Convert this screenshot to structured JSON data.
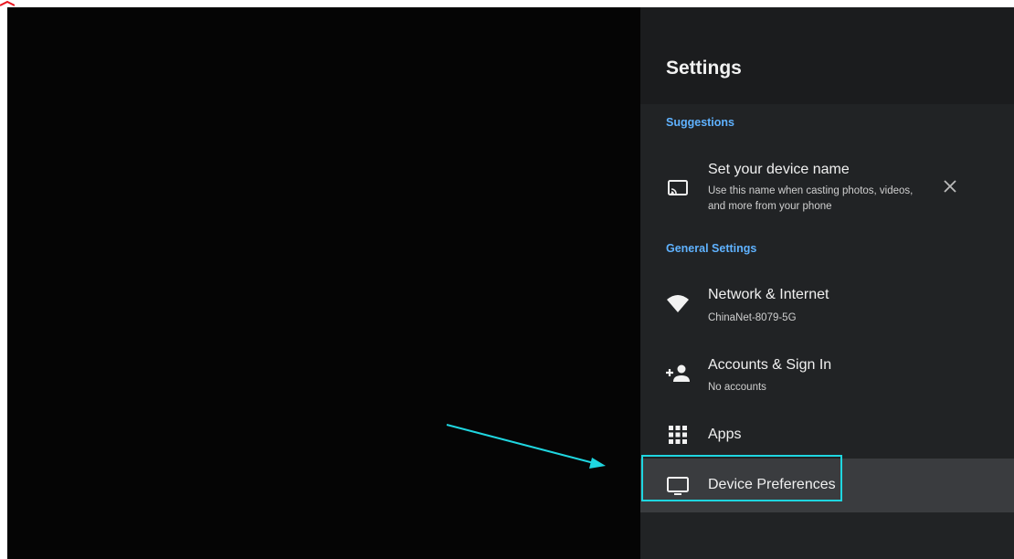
{
  "settings": {
    "title": "Settings",
    "suggestions_label": "Suggestions",
    "general_label": "General Settings",
    "suggestion": {
      "title": "Set your device name",
      "subtitle_line1": "Use this name when casting photos, videos,",
      "subtitle_line2": "and more from your phone",
      "icon": "cast-icon",
      "dismiss_icon": "close-icon"
    },
    "items": [
      {
        "title": "Network & Internet",
        "subtitle": "ChinaNet-8079-5G",
        "icon": "wifi-icon"
      },
      {
        "title": "Accounts & Sign In",
        "subtitle": "No accounts",
        "icon": "add-person-icon"
      },
      {
        "title": "Apps",
        "icon": "apps-grid-icon"
      },
      {
        "title": "Device Preferences",
        "icon": "tv-icon",
        "selected": true
      }
    ]
  },
  "colors": {
    "accent": "#5fb2ff",
    "focus_outline": "#1fd6e0",
    "annotation_arrow": "#1fd6e0",
    "panel_bg": "#212325",
    "header_bg": "#1b1c1e",
    "selected_bg": "#3a3c3f",
    "corner_mark": "#e8141e"
  }
}
